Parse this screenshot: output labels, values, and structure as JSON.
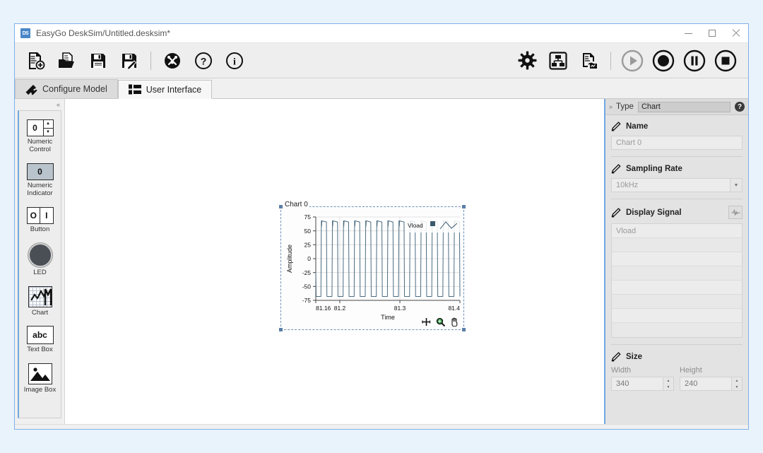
{
  "window": {
    "title": "EasyGo DeskSim/Untitled.desksim*",
    "badge": "DS",
    "controls": {
      "minimize": "minimize",
      "maximize": "maximize",
      "close": "close"
    }
  },
  "toolbar": {
    "left": [
      {
        "name": "new-file-button",
        "label": "New"
      },
      {
        "name": "open-file-button",
        "label": "Open"
      },
      {
        "name": "save-button",
        "label": "Save"
      },
      {
        "name": "save-as-button",
        "label": "Save As"
      },
      {
        "name": "tools-button",
        "label": "Tools"
      },
      {
        "name": "help-button",
        "label": "Help"
      },
      {
        "name": "about-button",
        "label": "About"
      }
    ],
    "right": [
      {
        "name": "settings-button",
        "label": "Settings"
      },
      {
        "name": "model-tree-button",
        "label": "Model Tree"
      },
      {
        "name": "export-report-button",
        "label": "Export Report"
      },
      {
        "name": "run-button",
        "label": "Run"
      },
      {
        "name": "record-button",
        "label": "Record"
      },
      {
        "name": "pause-button",
        "label": "Pause"
      },
      {
        "name": "stop-button",
        "label": "Stop"
      }
    ]
  },
  "tabs": [
    {
      "label": "Configure Model",
      "active": false
    },
    {
      "label": "User Interface",
      "active": true
    }
  ],
  "palette": {
    "collapse_handle": "«",
    "items": [
      {
        "label": "Numeric Control",
        "icon": "numeric-control-icon",
        "value": "0"
      },
      {
        "label": "Numeric Indicator",
        "icon": "numeric-indicator-icon",
        "value": "0"
      },
      {
        "label": "Button",
        "icon": "button-icon",
        "off": "O",
        "on": "I"
      },
      {
        "label": "LED",
        "icon": "led-icon"
      },
      {
        "label": "Chart",
        "icon": "chart-icon"
      },
      {
        "label": "Text Box",
        "icon": "text-box-icon",
        "value": "abc"
      },
      {
        "label": "Image Box",
        "icon": "image-box-icon"
      }
    ]
  },
  "canvas": {
    "chart_widget": {
      "title": "Chart 0",
      "tools": [
        {
          "name": "cursor-tool-icon",
          "label": "Cursor"
        },
        {
          "name": "zoom-tool-icon",
          "label": "Zoom"
        },
        {
          "name": "pan-tool-icon",
          "label": "Pan"
        }
      ]
    }
  },
  "chart_data": {
    "type": "line",
    "title": "Chart 0",
    "xlabel": "Time",
    "ylabel": "Amplitude",
    "xlim": [
      81.16,
      81.4
    ],
    "ylim": [
      -75,
      75
    ],
    "xticks": [
      "81.16",
      "81.2",
      "81.3",
      "81.4"
    ],
    "xtick_values": [
      81.16,
      81.2,
      81.3,
      81.4
    ],
    "yticks": [
      "75",
      "50",
      "25",
      "0",
      "-25",
      "-50",
      "-75"
    ],
    "ytick_values": [
      75,
      50,
      25,
      0,
      -25,
      -50,
      -75
    ],
    "grid": true,
    "legend": "Vload",
    "legend_position": "top-right",
    "line_color": "#4a6b80",
    "series": [
      {
        "name": "Vload",
        "waveform": "square",
        "amplitude": 68,
        "cycles": 13,
        "description": "Rectified square-like load voltage oscillating between -68 and +68"
      }
    ]
  },
  "properties": {
    "collapse_handle": "»",
    "type_label": "Type",
    "type_value": "Chart",
    "help": "?",
    "sections": {
      "name": {
        "title": "Name",
        "value": "Chart 0"
      },
      "sampling_rate": {
        "title": "Sampling Rate",
        "value": "10kHz"
      },
      "display_signal": {
        "title": "Display Signal",
        "rows": [
          "Vload",
          "",
          "",
          "",
          "",
          "",
          "",
          ""
        ]
      },
      "size": {
        "title": "Size",
        "width_label": "Width",
        "width_value": "340",
        "height_label": "Height",
        "height_value": "240"
      }
    }
  },
  "colors": {
    "accent": "#6fa8e0",
    "chart_line": "#4a6b80",
    "desktop": "#e9f3fc"
  }
}
